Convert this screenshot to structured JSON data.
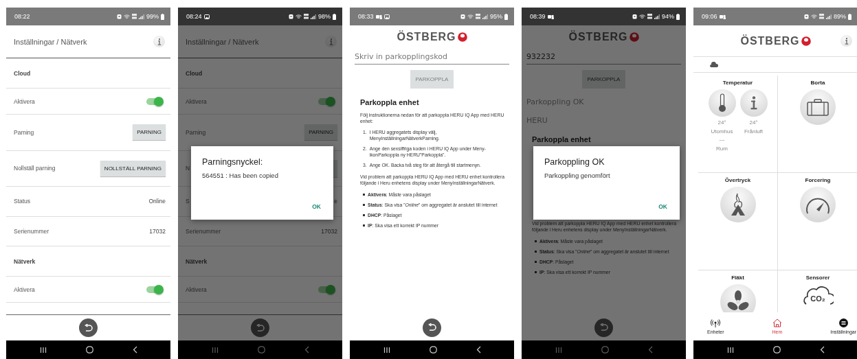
{
  "screens": [
    {
      "kind": "settings",
      "dimmed": false,
      "status_bar": {
        "time": "08:22",
        "battery": "99%"
      },
      "header": {
        "title": "Inställningar / Nätverk"
      },
      "rows": [
        {
          "kind": "section",
          "label": "Cloud"
        },
        {
          "kind": "toggle",
          "label": "Aktivera",
          "on": true
        },
        {
          "kind": "button",
          "label": "Parning",
          "button": "PARNING"
        },
        {
          "kind": "button",
          "label": "Nollställ parning",
          "button": "NOLLSTÄLL PARNING"
        },
        {
          "kind": "value",
          "label": "Status",
          "value": "Online"
        },
        {
          "kind": "value",
          "label": "Serienummer",
          "value": "17032"
        },
        {
          "kind": "section",
          "label": "Nätverk"
        },
        {
          "kind": "toggle",
          "label": "Aktivera",
          "on": true
        }
      ]
    },
    {
      "kind": "settings",
      "dimmed": true,
      "status_bar": {
        "time": "08:24",
        "battery": "98%"
      },
      "header": {
        "title": "Inställningar / Nätverk"
      },
      "rows": [
        {
          "kind": "section",
          "label": "Cloud"
        },
        {
          "kind": "toggle",
          "label": "Aktivera",
          "on": true
        },
        {
          "kind": "button",
          "label": "Parning",
          "button": "PARNING"
        },
        {
          "kind": "button",
          "label": "N"
        },
        {
          "kind": "value",
          "label": "S",
          "value": "e"
        },
        {
          "kind": "value",
          "label": "Serienummer",
          "value": "17032"
        },
        {
          "kind": "section",
          "label": "Nätverk"
        },
        {
          "kind": "toggle",
          "label": "Aktivera",
          "on": true
        }
      ],
      "dialog": {
        "title": "Parningsnyckel:",
        "message": "564551 : Has been copied",
        "button": "OK"
      }
    },
    {
      "kind": "pairing",
      "dimmed": false,
      "status_bar": {
        "time": "08:33",
        "battery": "95%"
      },
      "logo": "ÖSTBERG",
      "field": {
        "placeholder": "Skriv in parkopplingskod"
      },
      "button": {
        "label": "PARKOPPLA",
        "disabled": true
      },
      "instructions": {
        "heading": "Parkoppla enhet",
        "intro": "Följ instruktionerna nedan för att parkoppla HERU IQ App med HERU enhet:",
        "steps": [
          {
            "number": "1.",
            "text": "I HERU aggregatets display välj, MenyInställningarNätverkParning."
          },
          {
            "number": "2.",
            "text": "Ange den sexsiffriga koden i HERU IQ App under Meny-ikonParkoppla ny HERU\"Parkoppla\"."
          },
          {
            "number": "3.",
            "text": "Ange OK. Backa två steg för att återgå till startmenyn."
          }
        ],
        "note": "Vid problem att parkoppla HERU IQ App med HERU enhet kontrollera följande i Heru enhetens display under MenyInställningarNätverk.",
        "bullets": [
          "**Aktivera**: Måste vara påslaget",
          "**Status**: Ska visa ”*Online*” om aggregatet är anslutet till internet",
          "**DHCP**: Påslaget",
          "**IP**: Ska visa ett korrekt IP nummer"
        ]
      }
    },
    {
      "kind": "pairing",
      "dimmed": true,
      "status_bar": {
        "time": "08:39",
        "battery": "94%"
      },
      "logo": "ÖSTBERG",
      "field": {
        "value": "932232"
      },
      "button": {
        "label": "PARKOPPLA",
        "disabled": false
      },
      "results": [
        "Parkoppling OK",
        "HERU"
      ],
      "instructions": {
        "heading": "Parkoppla enhet",
        "note": "Vid problem att parkoppla HERU IQ App med HERU enhet kontrollera följande i Heru enhetens display under MenyInställningarNätverk.",
        "bullets": [
          "**Aktivera**: Måste vara påslaget",
          "**Status**: Ska visa ”*Online*” om aggregatet är anslutet till internet",
          "**DHCP**: Påslaget",
          "**IP**: Ska visa ett korrekt IP nummer"
        ]
      },
      "dialog": {
        "title": "Parkoppling OK",
        "message": "Parkoppling genomfört",
        "button": "OK"
      }
    },
    {
      "kind": "home",
      "dimmed": false,
      "status_bar": {
        "time": "09:06",
        "battery": "89%"
      },
      "logo": "ÖSTBERG",
      "tiles": [
        {
          "kind": "temperature",
          "title": "Temperatur",
          "sensors": [
            {
              "value": "24°",
              "label": "Utomhus"
            },
            {
              "value": "24°",
              "label": "Frånluft"
            },
            {
              "value": "---",
              "label": "Rum"
            }
          ]
        },
        {
          "kind": "action",
          "title": "Borta"
        },
        {
          "kind": "action",
          "title": "Övertryck"
        },
        {
          "kind": "action",
          "title": "Forcering"
        },
        {
          "kind": "action",
          "title": "Fläkt"
        },
        {
          "kind": "action",
          "title": "Sensorer",
          "icon_text": "CO₂"
        }
      ],
      "tabs": [
        {
          "label": "Enheter",
          "selected": false
        },
        {
          "label": "Hem",
          "selected": true
        },
        {
          "label": "Inställningar",
          "selected": false
        }
      ]
    }
  ]
}
